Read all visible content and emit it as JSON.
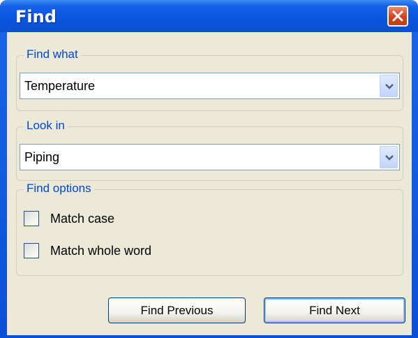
{
  "window": {
    "title": "Find"
  },
  "find_what": {
    "legend": "Find what",
    "value": "Temperature"
  },
  "look_in": {
    "legend": "Look in",
    "value": "Piping"
  },
  "find_options": {
    "legend": "Find options",
    "match_case": {
      "label": "Match case",
      "checked": false
    },
    "match_whole_word": {
      "label": "Match whole word",
      "checked": false
    }
  },
  "buttons": {
    "find_previous": "Find Previous",
    "find_next": "Find Next"
  },
  "icons": {
    "close": "close-icon",
    "dropdown": "chevron-down-icon"
  },
  "colors": {
    "title_bar": "#0a55dd",
    "close_button": "#d4421c",
    "legend_text": "#0046d5",
    "dialog_background": "#ece9d8"
  }
}
